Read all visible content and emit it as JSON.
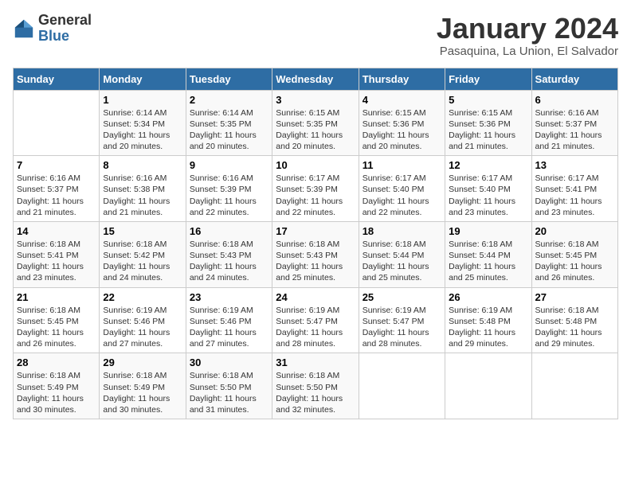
{
  "logo": {
    "general": "General",
    "blue": "Blue"
  },
  "header": {
    "title": "January 2024",
    "subtitle": "Pasaquina, La Union, El Salvador"
  },
  "weekdays": [
    "Sunday",
    "Monday",
    "Tuesday",
    "Wednesday",
    "Thursday",
    "Friday",
    "Saturday"
  ],
  "weeks": [
    [
      {
        "day": "",
        "info": ""
      },
      {
        "day": "1",
        "info": "Sunrise: 6:14 AM\nSunset: 5:34 PM\nDaylight: 11 hours\nand 20 minutes."
      },
      {
        "day": "2",
        "info": "Sunrise: 6:14 AM\nSunset: 5:35 PM\nDaylight: 11 hours\nand 20 minutes."
      },
      {
        "day": "3",
        "info": "Sunrise: 6:15 AM\nSunset: 5:35 PM\nDaylight: 11 hours\nand 20 minutes."
      },
      {
        "day": "4",
        "info": "Sunrise: 6:15 AM\nSunset: 5:36 PM\nDaylight: 11 hours\nand 20 minutes."
      },
      {
        "day": "5",
        "info": "Sunrise: 6:15 AM\nSunset: 5:36 PM\nDaylight: 11 hours\nand 21 minutes."
      },
      {
        "day": "6",
        "info": "Sunrise: 6:16 AM\nSunset: 5:37 PM\nDaylight: 11 hours\nand 21 minutes."
      }
    ],
    [
      {
        "day": "7",
        "info": "Sunrise: 6:16 AM\nSunset: 5:37 PM\nDaylight: 11 hours\nand 21 minutes."
      },
      {
        "day": "8",
        "info": "Sunrise: 6:16 AM\nSunset: 5:38 PM\nDaylight: 11 hours\nand 21 minutes."
      },
      {
        "day": "9",
        "info": "Sunrise: 6:16 AM\nSunset: 5:39 PM\nDaylight: 11 hours\nand 22 minutes."
      },
      {
        "day": "10",
        "info": "Sunrise: 6:17 AM\nSunset: 5:39 PM\nDaylight: 11 hours\nand 22 minutes."
      },
      {
        "day": "11",
        "info": "Sunrise: 6:17 AM\nSunset: 5:40 PM\nDaylight: 11 hours\nand 22 minutes."
      },
      {
        "day": "12",
        "info": "Sunrise: 6:17 AM\nSunset: 5:40 PM\nDaylight: 11 hours\nand 23 minutes."
      },
      {
        "day": "13",
        "info": "Sunrise: 6:17 AM\nSunset: 5:41 PM\nDaylight: 11 hours\nand 23 minutes."
      }
    ],
    [
      {
        "day": "14",
        "info": "Sunrise: 6:18 AM\nSunset: 5:41 PM\nDaylight: 11 hours\nand 23 minutes."
      },
      {
        "day": "15",
        "info": "Sunrise: 6:18 AM\nSunset: 5:42 PM\nDaylight: 11 hours\nand 24 minutes."
      },
      {
        "day": "16",
        "info": "Sunrise: 6:18 AM\nSunset: 5:43 PM\nDaylight: 11 hours\nand 24 minutes."
      },
      {
        "day": "17",
        "info": "Sunrise: 6:18 AM\nSunset: 5:43 PM\nDaylight: 11 hours\nand 25 minutes."
      },
      {
        "day": "18",
        "info": "Sunrise: 6:18 AM\nSunset: 5:44 PM\nDaylight: 11 hours\nand 25 minutes."
      },
      {
        "day": "19",
        "info": "Sunrise: 6:18 AM\nSunset: 5:44 PM\nDaylight: 11 hours\nand 25 minutes."
      },
      {
        "day": "20",
        "info": "Sunrise: 6:18 AM\nSunset: 5:45 PM\nDaylight: 11 hours\nand 26 minutes."
      }
    ],
    [
      {
        "day": "21",
        "info": "Sunrise: 6:18 AM\nSunset: 5:45 PM\nDaylight: 11 hours\nand 26 minutes."
      },
      {
        "day": "22",
        "info": "Sunrise: 6:19 AM\nSunset: 5:46 PM\nDaylight: 11 hours\nand 27 minutes."
      },
      {
        "day": "23",
        "info": "Sunrise: 6:19 AM\nSunset: 5:46 PM\nDaylight: 11 hours\nand 27 minutes."
      },
      {
        "day": "24",
        "info": "Sunrise: 6:19 AM\nSunset: 5:47 PM\nDaylight: 11 hours\nand 28 minutes."
      },
      {
        "day": "25",
        "info": "Sunrise: 6:19 AM\nSunset: 5:47 PM\nDaylight: 11 hours\nand 28 minutes."
      },
      {
        "day": "26",
        "info": "Sunrise: 6:19 AM\nSunset: 5:48 PM\nDaylight: 11 hours\nand 29 minutes."
      },
      {
        "day": "27",
        "info": "Sunrise: 6:18 AM\nSunset: 5:48 PM\nDaylight: 11 hours\nand 29 minutes."
      }
    ],
    [
      {
        "day": "28",
        "info": "Sunrise: 6:18 AM\nSunset: 5:49 PM\nDaylight: 11 hours\nand 30 minutes."
      },
      {
        "day": "29",
        "info": "Sunrise: 6:18 AM\nSunset: 5:49 PM\nDaylight: 11 hours\nand 30 minutes."
      },
      {
        "day": "30",
        "info": "Sunrise: 6:18 AM\nSunset: 5:50 PM\nDaylight: 11 hours\nand 31 minutes."
      },
      {
        "day": "31",
        "info": "Sunrise: 6:18 AM\nSunset: 5:50 PM\nDaylight: 11 hours\nand 32 minutes."
      },
      {
        "day": "",
        "info": ""
      },
      {
        "day": "",
        "info": ""
      },
      {
        "day": "",
        "info": ""
      }
    ]
  ]
}
